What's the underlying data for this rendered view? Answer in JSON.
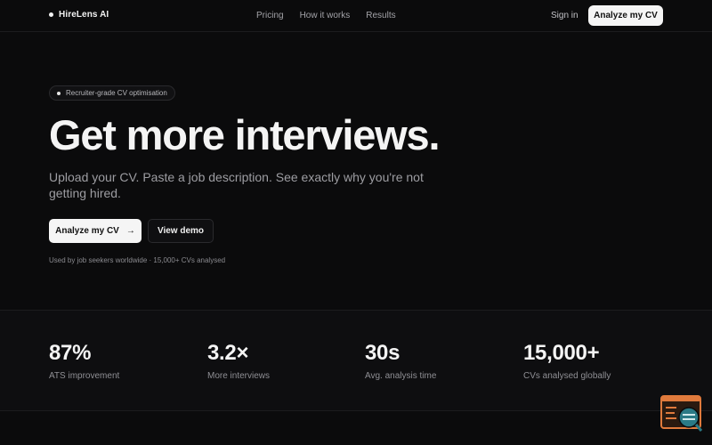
{
  "nav": {
    "brand": "HireLens AI",
    "links": [
      "Pricing",
      "How it works",
      "Results"
    ],
    "signin": "Sign in",
    "cta": "Analyze my CV"
  },
  "hero": {
    "badge": "Recruiter-grade CV optimisation",
    "title": "Get more interviews.",
    "subtitle": "Upload your CV. Paste a job description. See exactly why you're not getting hired.",
    "primary_button": "Analyze my CV",
    "secondary_button": "View demo",
    "social_proof": "Used by job seekers worldwide · 15,000+ CVs analysed"
  },
  "stats": [
    {
      "value": "87%",
      "label": "ATS improvement"
    },
    {
      "value": "3.2×",
      "label": "More interviews"
    },
    {
      "value": "30s",
      "label": "Avg. analysis time"
    },
    {
      "value": "15,000+",
      "label": "CVs analysed globally"
    }
  ],
  "icons": {
    "arrow": "arrow-right-icon",
    "widget": "cv-search-widget-icon"
  },
  "colors": {
    "background": "#0b0b0c",
    "accent": "#f5f5f5",
    "widget_orange": "#e07a3c",
    "widget_teal": "#2a7a86"
  }
}
